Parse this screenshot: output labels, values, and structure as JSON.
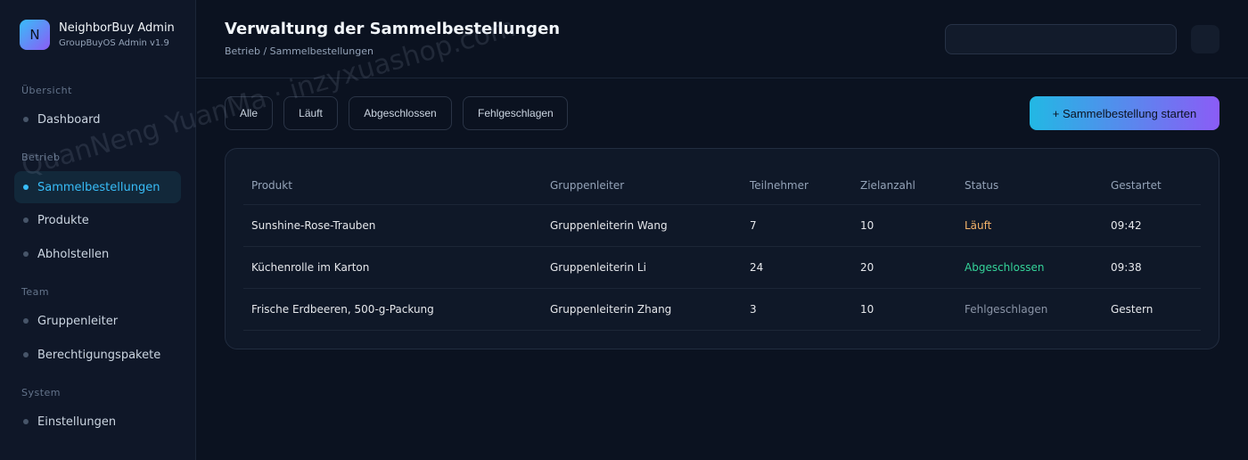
{
  "brand": {
    "logo_letter": "N",
    "name": "NeighborBuy Admin",
    "subtitle": "GroupBuyOS Admin v1.9"
  },
  "sidebar": {
    "sections": [
      {
        "label": "Übersicht",
        "items": [
          {
            "label": "Dashboard",
            "active": false
          }
        ]
      },
      {
        "label": "Betrieb",
        "items": [
          {
            "label": "Sammelbestellungen",
            "active": true
          },
          {
            "label": "Produkte",
            "active": false
          },
          {
            "label": "Abholstellen",
            "active": false
          }
        ]
      },
      {
        "label": "Team",
        "items": [
          {
            "label": "Gruppenleiter",
            "active": false
          },
          {
            "label": "Berechtigungspakete",
            "active": false
          }
        ]
      },
      {
        "label": "System",
        "items": [
          {
            "label": "Einstellungen",
            "active": false
          }
        ]
      }
    ]
  },
  "header": {
    "title": "Verwaltung der Sammelbestellungen",
    "breadcrumb": "Betrieb / Sammelbestellungen",
    "search_value": ""
  },
  "filters": [
    "Alle",
    "Läuft",
    "Abgeschlossen",
    "Fehlgeschlagen"
  ],
  "primary_action": "+ Sammelbestellung starten",
  "table": {
    "columns": [
      "Produkt",
      "Gruppenleiter",
      "Teilnehmer",
      "Zielanzahl",
      "Status",
      "Gestartet"
    ],
    "rows": [
      [
        "Sunshine-Rose-Trauben",
        "Gruppenleiterin Wang",
        "7",
        "10",
        "Läuft",
        "09:42"
      ],
      [
        "Küchenrolle im Karton",
        "Gruppenleiterin Li",
        "24",
        "20",
        "Abgeschlossen",
        "09:38"
      ],
      [
        "Frische Erdbeeren, 500-g-Packung",
        "Gruppenleiterin Zhang",
        "3",
        "10",
        "Fehlgeschlagen",
        "Gestern"
      ]
    ]
  },
  "status_colors": {
    "Läuft": "#f5b46a",
    "Abgeschlossen": "#34d399",
    "Fehlgeschlagen": "#8b95a7"
  },
  "colors": {
    "accent": "#38bdf8",
    "accent_secondary": "#8b5cf6",
    "background": "#0b1220"
  },
  "watermark": "QuanNeng YuanMa · inzyxuashop.com"
}
